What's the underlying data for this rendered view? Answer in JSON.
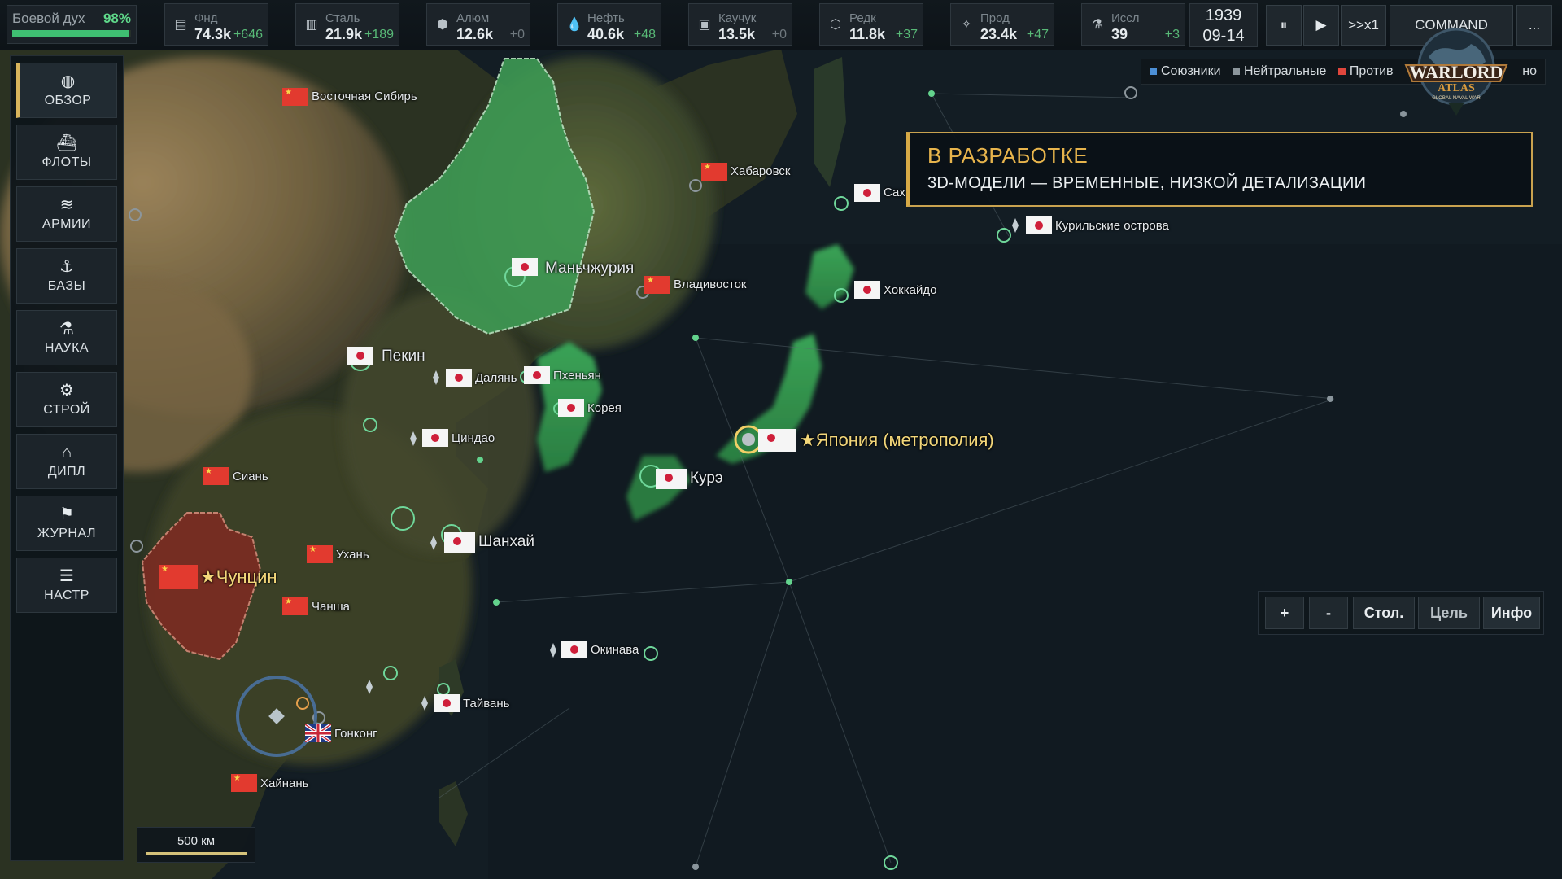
{
  "topbar": {
    "morale": {
      "label": "Боевой дух",
      "value": "98%",
      "level": 0.98
    },
    "resources": [
      {
        "icon": "coins-icon",
        "glyph": "▤",
        "name": "Фнд",
        "amount": "74.3k",
        "delta": "+646"
      },
      {
        "icon": "steel-icon",
        "glyph": "▥",
        "name": "Сталь",
        "amount": "21.9k",
        "delta": "+189"
      },
      {
        "icon": "aluminum-icon",
        "glyph": "⬢",
        "name": "Алюм",
        "amount": "12.6k",
        "delta": "+0"
      },
      {
        "icon": "oil-drop-icon",
        "glyph": "💧",
        "name": "Нефть",
        "amount": "40.6k",
        "delta": "+48"
      },
      {
        "icon": "rubber-icon",
        "glyph": "▣",
        "name": "Каучук",
        "amount": "13.5k",
        "delta": "+0"
      },
      {
        "icon": "rare-metal-icon",
        "glyph": "⬡",
        "name": "Редк",
        "amount": "11.8k",
        "delta": "+37"
      },
      {
        "icon": "food-icon",
        "glyph": "✧",
        "name": "Прод",
        "amount": "23.4k",
        "delta": "+47"
      },
      {
        "icon": "flask-icon",
        "glyph": "⚗",
        "name": "Иссл",
        "amount": "39",
        "delta": "+3"
      }
    ],
    "date_year": "1939",
    "date_day": "09-14",
    "pause_label": "⏸",
    "play_label": "▶",
    "speed_label": ">>x1",
    "command_label": "COMMAND",
    "more_label": "..."
  },
  "logo": {
    "line1": "WARLORD",
    "line2": "ATLAS",
    "line3": "GLOBAL NAVAL WAR"
  },
  "legend": {
    "allies": "Союзники",
    "neutral": "Нейтральные",
    "enemies": "Против",
    "tail": "но",
    "colors": {
      "allies": "#4c8fd6",
      "neutral": "#8c969c",
      "enemies": "#e0463c"
    }
  },
  "banner": {
    "title": "В РАЗРАБОТКЕ",
    "text": "3D-МОДЕЛИ — ВРЕМЕННЫЕ, НИЗКОЙ ДЕТАЛИЗАЦИИ"
  },
  "sidebar": {
    "items": [
      {
        "id": "overview",
        "icon": "globe-icon",
        "glyph": "◍",
        "label": "ОБЗОР"
      },
      {
        "id": "fleets",
        "icon": "ship-icon",
        "glyph": "⛴",
        "label": "ФЛОТЫ"
      },
      {
        "id": "armies",
        "icon": "chevrons-icon",
        "glyph": "≋",
        "label": "АРМИИ"
      },
      {
        "id": "bases",
        "icon": "anchor-icon",
        "glyph": "⚓",
        "label": "БАЗЫ"
      },
      {
        "id": "science",
        "icon": "flask-icon",
        "glyph": "⚗",
        "label": "НАУКА"
      },
      {
        "id": "build",
        "icon": "gear-icon",
        "glyph": "⚙",
        "label": "СТРОЙ"
      },
      {
        "id": "diplomacy",
        "icon": "building-icon",
        "glyph": "⌂",
        "label": "ДИПЛ"
      },
      {
        "id": "journal",
        "icon": "flag-icon",
        "glyph": "⚑",
        "label": "ЖУРНАЛ"
      },
      {
        "id": "settings",
        "icon": "sliders-icon",
        "glyph": "☰",
        "label": "НАСТР"
      }
    ]
  },
  "map": {
    "places": {
      "east_siberia": "Восточная Сибирь",
      "khabarovsk": "Хабаровск",
      "sakhalin": "Сахалин (Карафуто)",
      "kuril": "Курильские острова",
      "manchuria": "Маньчжурия",
      "vladivostok": "Владивосток",
      "hokkaido": "Хоккайдо",
      "beijing": "Пекин",
      "dalian": "Далянь",
      "pyongyang": "Пхеньян",
      "korea": "Корея",
      "qingdao": "Циндао",
      "japan": "★Япония (метрополия)",
      "kure": "Курэ",
      "xian": "Сиань",
      "shanghai": "Шанхай",
      "wuhan": "Ухань",
      "chongqing": "★Чунцин",
      "changsha": "Чанша",
      "okinawa": "Окинава",
      "taiwan": "Тайвань",
      "hongkong": "Гонконг",
      "hainan": "Хайнань"
    }
  },
  "mapctrl": {
    "zoom_in": "+",
    "zoom_out": "-",
    "capital": "Стол.",
    "target": "Цель",
    "info": "Инфо"
  },
  "scale": {
    "label": "500 км"
  }
}
